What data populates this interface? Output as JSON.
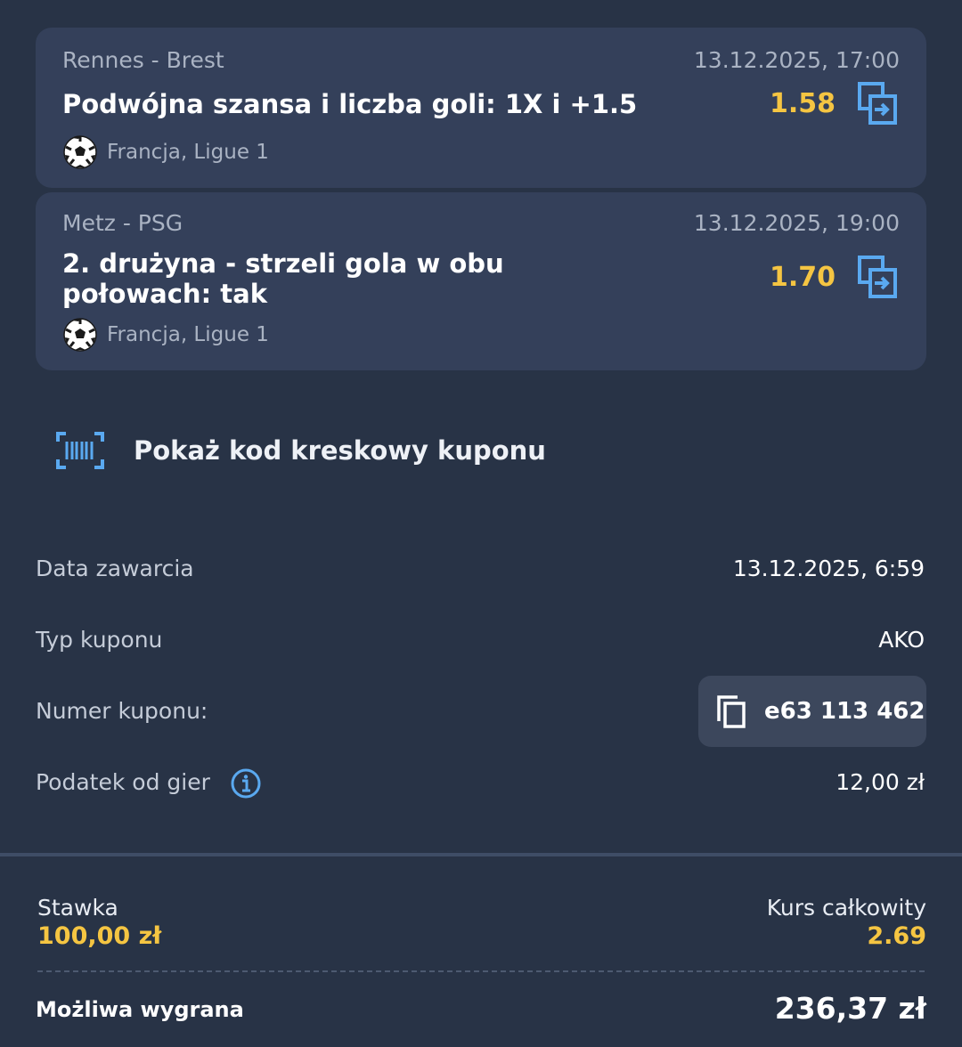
{
  "events": [
    {
      "teams": "Rennes - Brest",
      "datetime": "13.12.2025, 17:00",
      "market": "Podwójna szansa i liczba goli: 1X i +1.5",
      "odds": "1.58",
      "league": "Francja, Ligue 1",
      "icons": [
        "soccer-ball-icon",
        "copy-to-bet-icon"
      ]
    },
    {
      "teams": "Metz - PSG",
      "datetime": "13.12.2025, 19:00",
      "market": "2. drużyna - strzeli gola w obu połowach: tak",
      "odds": "1.70",
      "league": "Francja, Ligue 1",
      "icons": [
        "soccer-ball-icon",
        "copy-to-bet-icon"
      ]
    }
  ],
  "barcode": {
    "label": "Pokaż kod kreskowy kuponu",
    "icon": "barcode-icon"
  },
  "details": {
    "date_label": "Data zawarcia",
    "date_value": "13.12.2025, 6:59",
    "type_label": "Typ kuponu",
    "type_value": "AKO",
    "number_label": "Numer kuponu:",
    "number_value": "e63 113 462",
    "tax_label": "Podatek od gier",
    "tax_value": "12,00 zł"
  },
  "summary": {
    "stake_label": "Stawka",
    "stake_value": "100,00 zł",
    "total_odds_label": "Kurs całkowity",
    "total_odds_value": "2.69",
    "win_label": "Możliwa wygrana",
    "win_value": "236,37 zł"
  },
  "colors": {
    "background": "#283346",
    "card": "#34405a",
    "accent_yellow": "#f5c542",
    "accent_blue": "#5aa9f0"
  }
}
